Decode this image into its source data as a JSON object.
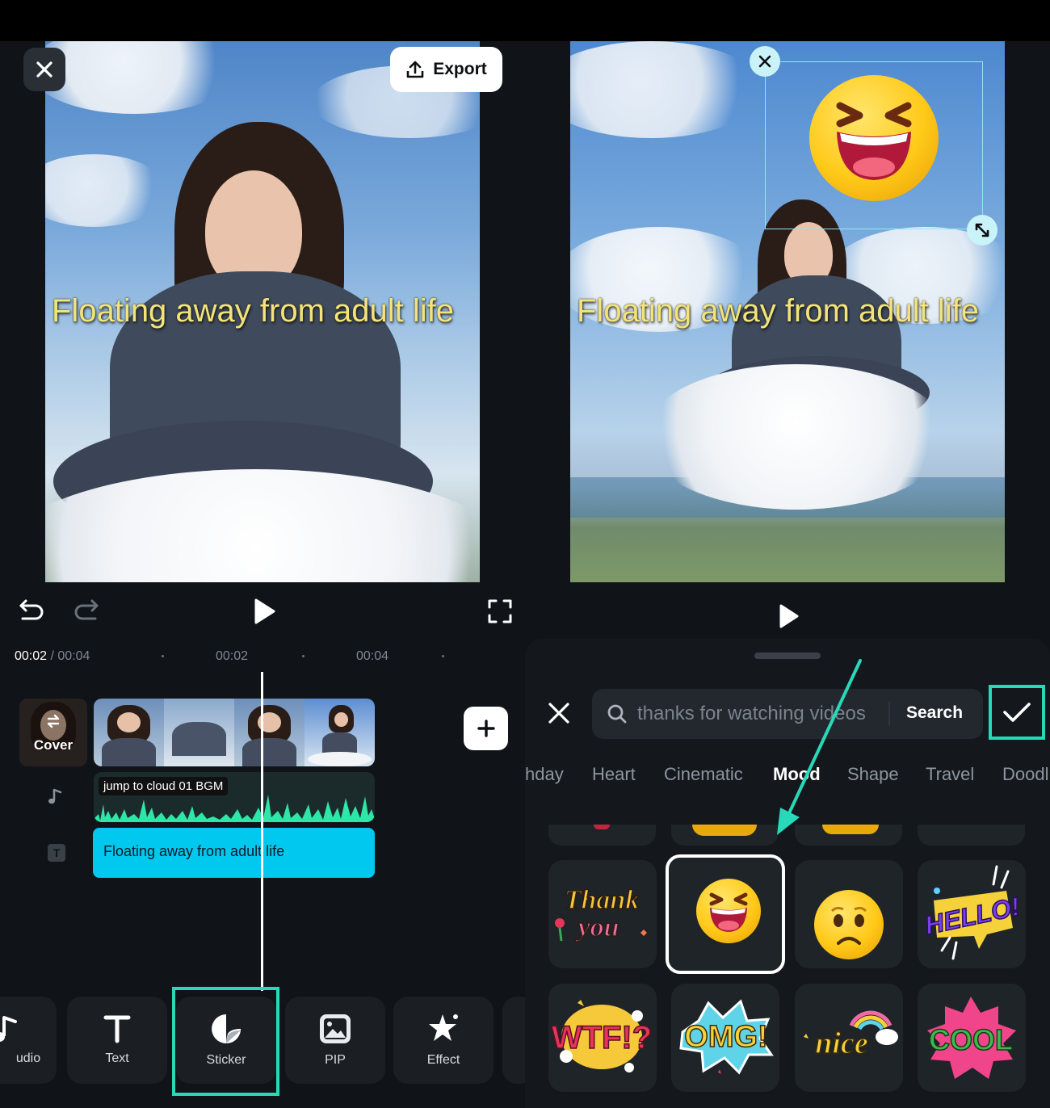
{
  "left": {
    "close_icon": "close-icon",
    "export_label": "Export",
    "caption": "Floating away from adult life",
    "controls": {
      "undo": "undo-icon",
      "redo": "redo-icon",
      "play": "play-icon",
      "fullscreen": "fullscreen-icon"
    },
    "time": {
      "current": "00:02",
      "separator": " / ",
      "total": "00:04",
      "ruler_marks": [
        "00:02",
        "00:04"
      ]
    },
    "timeline": {
      "cover_label": "Cover",
      "audio_label": "jump to cloud 01 BGM",
      "text_track_label": "Floating away from adult life"
    },
    "tools": [
      {
        "label": "udio",
        "icon": "music-note-icon"
      },
      {
        "label": "Text",
        "icon": "text-icon"
      },
      {
        "label": "Sticker",
        "icon": "sticker-icon"
      },
      {
        "label": "PIP",
        "icon": "image-icon"
      },
      {
        "label": "Effect",
        "icon": "sparkle-icon"
      }
    ]
  },
  "right": {
    "caption": "Floating away from adult life",
    "play": "play-icon",
    "sheet": {
      "search_placeholder": "thanks for watching videos",
      "search_button": "Search",
      "categories": [
        "hday",
        "Heart",
        "Cinematic",
        "Mood",
        "Shape",
        "Travel",
        "Doodl"
      ],
      "active_category": "Mood",
      "stickers": [
        {
          "name": "thank-you-sticker",
          "text": "Thank you"
        },
        {
          "name": "laughing-emoji-sticker",
          "text": ""
        },
        {
          "name": "sad-emoji-sticker",
          "text": ""
        },
        {
          "name": "hello-sticker",
          "text": "HELLO!"
        },
        {
          "name": "wtf-sticker",
          "text": "WTF!?"
        },
        {
          "name": "omg-sticker",
          "text": "OMG!"
        },
        {
          "name": "nice-sticker",
          "text": "nice"
        },
        {
          "name": "cool-sticker",
          "text": "COOL"
        }
      ]
    }
  },
  "colors": {
    "accent_teal": "#27d9b9",
    "text_track": "#00c8ee",
    "caption_yellow": "#f2e37a",
    "panel_bg": "#101418"
  }
}
